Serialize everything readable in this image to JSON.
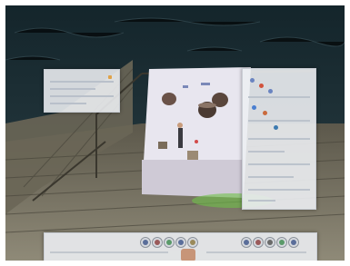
{
  "scene": {
    "description_colors": {
      "water": "#1d2d33",
      "dock_wood": "#6f6a5a",
      "building_floor": "#e9e6f0",
      "accent_green": "#6fc24a"
    }
  },
  "panels": {
    "left": {
      "icon": "info-panel-icon"
    },
    "right": {
      "icon": "details-panel-icon"
    },
    "bottom": {
      "left_slots": [
        "build-icon",
        "people-icon",
        "goods-icon",
        "ship-icon",
        "map-icon"
      ],
      "right_slots": [
        "trade-icon",
        "flag-icon",
        "options-icon",
        "speed-icon",
        "menu-icon"
      ]
    }
  }
}
